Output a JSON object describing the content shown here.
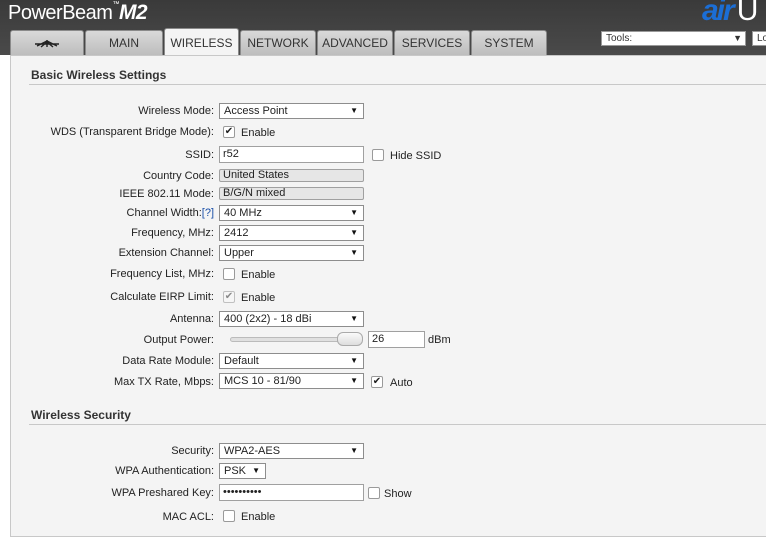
{
  "brand": {
    "product": "PowerBeam",
    "model": "M2",
    "tm": "™",
    "air": "air",
    "u": "U"
  },
  "tabs": [
    "MAIN",
    "WIRELESS",
    "NETWORK",
    "ADVANCED",
    "SERVICES",
    "SYSTEM"
  ],
  "tools": {
    "label": "Tools:",
    "logout": "Lo"
  },
  "basic": {
    "title": "Basic Wireless Settings",
    "wireless_mode": {
      "label": "Wireless Mode:",
      "value": "Access Point"
    },
    "wds": {
      "label": "WDS (Transparent Bridge Mode):",
      "option": "Enable",
      "checked": true
    },
    "ssid": {
      "label": "SSID:",
      "value": "r52",
      "hide_label": "Hide SSID"
    },
    "country": {
      "label": "Country Code:",
      "value": "United States"
    },
    "ieee": {
      "label": "IEEE 802.11 Mode:",
      "value": "B/G/N mixed"
    },
    "channel_width": {
      "label": "Channel Width:",
      "help": "[?]",
      "value": "40 MHz"
    },
    "frequency": {
      "label": "Frequency, MHz:",
      "value": "2412"
    },
    "extension": {
      "label": "Extension Channel:",
      "value": "Upper"
    },
    "freq_list": {
      "label": "Frequency List, MHz:",
      "option": "Enable"
    },
    "eirp": {
      "label": "Calculate EIRP Limit:",
      "option": "Enable"
    },
    "antenna": {
      "label": "Antenna:",
      "value": "400 (2x2) - 18 dBi"
    },
    "output_power": {
      "label": "Output Power:",
      "value": "26",
      "unit": "dBm",
      "level": 1.0
    },
    "data_rate": {
      "label": "Data Rate Module:",
      "value": "Default"
    },
    "max_tx": {
      "label": "Max TX Rate, Mbps:",
      "value": "MCS 10 - 81/90",
      "auto_label": "Auto"
    }
  },
  "security": {
    "title": "Wireless Security",
    "security": {
      "label": "Security:",
      "value": "WPA2-AES"
    },
    "wpa_auth": {
      "label": "WPA Authentication:",
      "value": "PSK"
    },
    "wpa_key": {
      "label": "WPA Preshared Key:",
      "value": "••••••••••",
      "show_label": "Show"
    },
    "mac_acl": {
      "label": "MAC ACL:",
      "option": "Enable"
    }
  }
}
